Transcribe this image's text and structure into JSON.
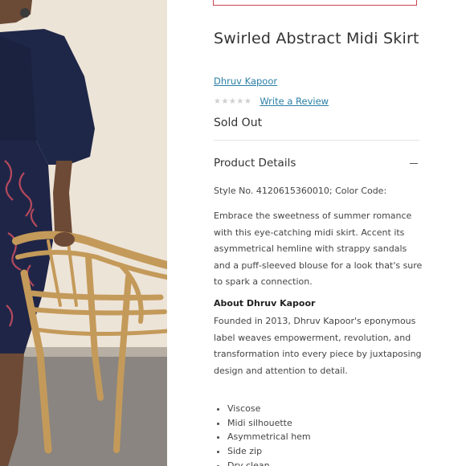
{
  "product": {
    "title": "Swirled Abstract Midi Skirt",
    "brand": "Dhruv Kapoor",
    "rating_stars": "★★★★★",
    "rating_value": 0,
    "review_link": "Write a Review",
    "availability": "Sold Out"
  },
  "details": {
    "header": "Product Details",
    "style_line": "Style No. 4120615360010; Color Code:",
    "description": "Embrace the sweetness of summer romance with this eye-catching midi skirt. Accent its asymmetrical hemline with strappy sandals and a puff-sleeved blouse for a look that's sure to spark a connection.",
    "about_title": "About Dhruv Kapoor",
    "about_text": "Founded in 2013, Dhruv Kapoor's eponymous label weaves empowerment, revolution, and transformation into every piece by juxtaposing design and attention to detail.",
    "features": [
      "Viscose",
      "Midi silhouette",
      "Asymmetrical hem",
      "Side zip",
      "Dry clean"
    ]
  },
  "icons": {
    "collapse": "minus-icon"
  },
  "colors": {
    "link": "#2b7fa6",
    "accent_border": "#c9434f",
    "text": "#333333"
  }
}
